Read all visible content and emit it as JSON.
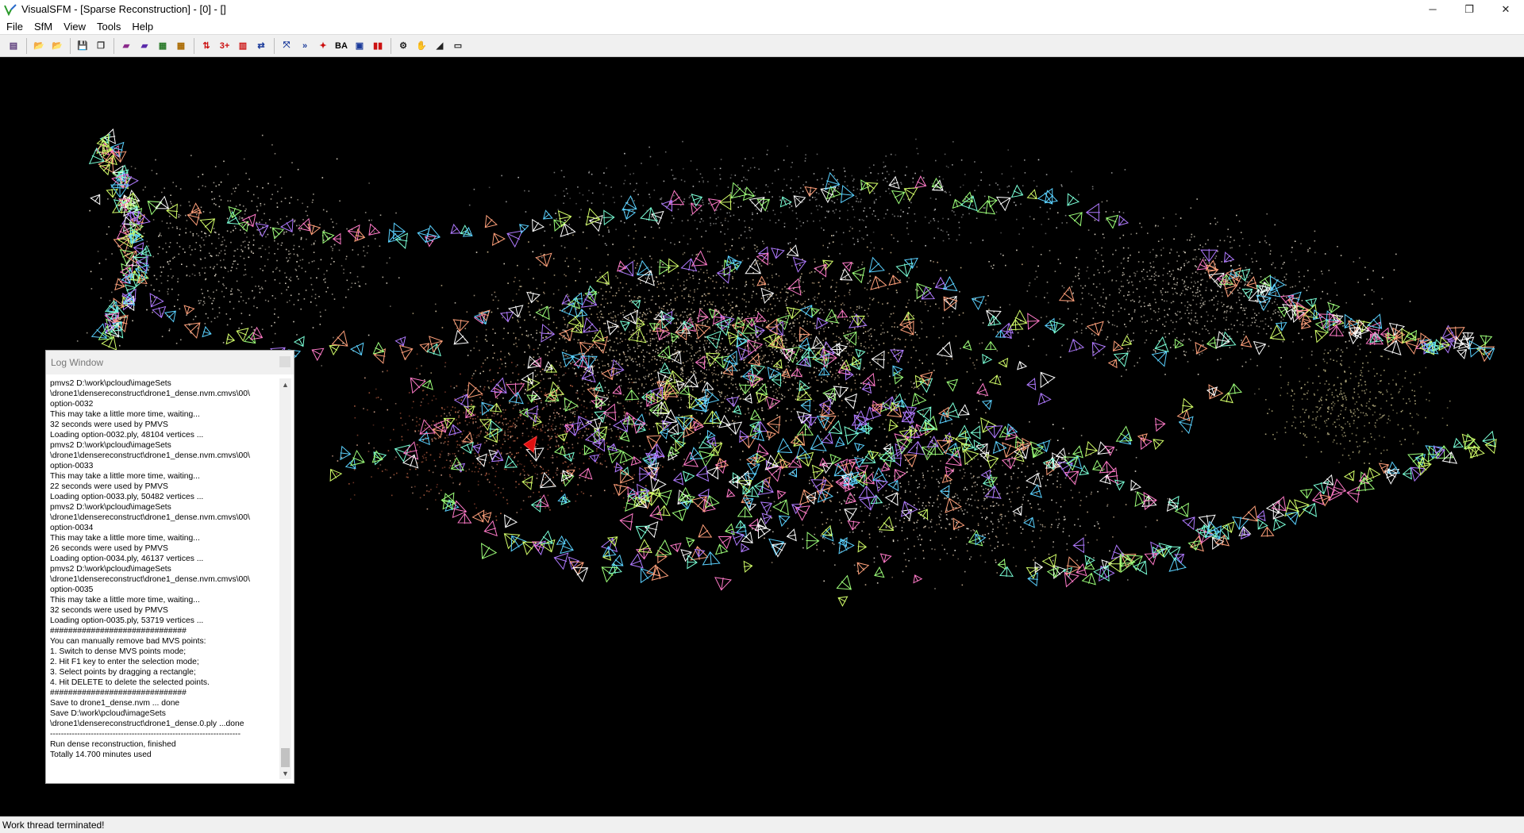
{
  "window": {
    "title": "VisualSFM - [Sparse Reconstruction] - [0] - []",
    "minimize": "─",
    "restore": "❐",
    "close": "✕"
  },
  "menu": [
    "File",
    "SfM",
    "View",
    "Tools",
    "Help"
  ],
  "toolbar": {
    "items": [
      {
        "icon": "log-icon",
        "glyph": "▤",
        "color": "#5a3a7a"
      },
      {
        "sep": true
      },
      {
        "icon": "open-multi-images-icon",
        "glyph": "📂",
        "color": "#2a6a8a"
      },
      {
        "icon": "open-nvm-icon",
        "glyph": "📂",
        "color": "#2a6a8a"
      },
      {
        "sep": true
      },
      {
        "icon": "save-icon",
        "glyph": "💾",
        "color": "#333"
      },
      {
        "icon": "copy-icon",
        "glyph": "❐",
        "color": "#333"
      },
      {
        "sep": true
      },
      {
        "icon": "pair-images-icon",
        "glyph": "▰",
        "color": "#8b2a8b"
      },
      {
        "icon": "show-features-icon",
        "glyph": "▰",
        "color": "#5a2aaa"
      },
      {
        "icon": "show-matches-icon",
        "glyph": "▦",
        "color": "#2a7a2a"
      },
      {
        "icon": "show-thumbnails-icon",
        "glyph": "▦",
        "color": "#aa6a00"
      },
      {
        "sep": true
      },
      {
        "icon": "compute-missing-match-icon",
        "glyph": "⇅",
        "color": "#cc1111"
      },
      {
        "icon": "compute-3d-icon",
        "glyph": "3+",
        "color": "#cc1111"
      },
      {
        "icon": "dense-reconstruction-icon",
        "glyph": "▥",
        "color": "#cc1111"
      },
      {
        "icon": "reconstruction-mode-icon",
        "glyph": "⇄",
        "color": "#1a3a9a"
      },
      {
        "sep": true
      },
      {
        "icon": "fit-view-icon",
        "glyph": "⤧",
        "color": "#1a3a9a"
      },
      {
        "icon": "next-step-icon",
        "glyph": "»",
        "color": "#1a3a9a"
      },
      {
        "icon": "run-all-icon",
        "glyph": "✦",
        "color": "#cc1111"
      },
      {
        "icon": "bundle-adjustment-icon",
        "glyph": "BA",
        "color": "#000"
      },
      {
        "icon": "match-icon",
        "glyph": "▣",
        "color": "#1a3a9a"
      },
      {
        "icon": "pause-icon",
        "glyph": "▮▮",
        "color": "#cc1111"
      },
      {
        "sep": true
      },
      {
        "icon": "settings-gear-icon",
        "glyph": "⚙",
        "color": "#222"
      },
      {
        "icon": "hand-pan-icon",
        "glyph": "✋",
        "color": "#222"
      },
      {
        "icon": "ruler-icon",
        "glyph": "◢",
        "color": "#222"
      },
      {
        "icon": "fullscreen-icon",
        "glyph": "▭",
        "color": "#222"
      }
    ]
  },
  "log_window": {
    "title": "Log Window",
    "lines": [
      "pmvs2 D:\\work\\pcloud\\imageSets",
      "\\drone1\\densereconstruct\\drone1_dense.nvm.cmvs\\00\\",
      "option-0032",
      "This may take a little more time, waiting...",
      "32 seconds were used by PMVS",
      "Loading option-0032.ply, 48104 vertices ...",
      "pmvs2 D:\\work\\pcloud\\imageSets",
      "\\drone1\\densereconstruct\\drone1_dense.nvm.cmvs\\00\\",
      "option-0033",
      "This may take a little more time, waiting...",
      "22 seconds were used by PMVS",
      "Loading option-0033.ply, 50482 vertices ...",
      "pmvs2 D:\\work\\pcloud\\imageSets",
      "\\drone1\\densereconstruct\\drone1_dense.nvm.cmvs\\00\\",
      "option-0034",
      "This may take a little more time, waiting...",
      "26 seconds were used by PMVS",
      "Loading option-0034.ply, 46137 vertices ...",
      "pmvs2 D:\\work\\pcloud\\imageSets",
      "\\drone1\\densereconstruct\\drone1_dense.nvm.cmvs\\00\\",
      "option-0035",
      "This may take a little more time, waiting...",
      "32 seconds were used by PMVS",
      "Loading option-0035.ply, 53719 vertices ...",
      "##############################",
      "You can manually remove bad MVS points:",
      "1. Switch to dense MVS points mode;",
      "2. Hit F1 key to enter the selection mode;",
      "3. Select points by dragging a rectangle;",
      "4. Hit DELETE to delete the selected points.",
      "##############################",
      "Save to drone1_dense.nvm ... done",
      "Save D:\\work\\pcloud\\imageSets",
      "\\drone1\\densereconstruct\\drone1_dense.0.ply ...done",
      "----------------------------------------------------------------------",
      "Run dense reconstruction, finished",
      "Totally 14.700 minutes used"
    ]
  },
  "status": "Work thread terminated!"
}
